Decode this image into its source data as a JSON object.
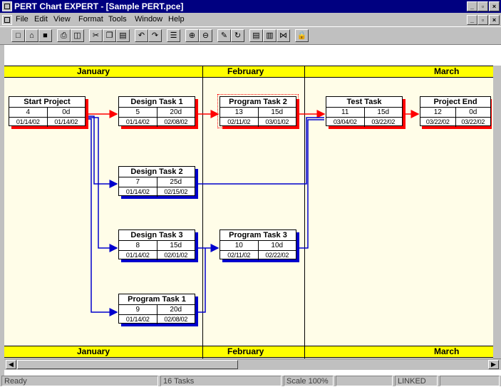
{
  "window": {
    "title": "PERT Chart EXPERT - [Sample PERT.pce]"
  },
  "menu": [
    "File",
    "Edit",
    "View",
    "Format",
    "Tools",
    "Window",
    "Help"
  ],
  "toolbar": {
    "icons": [
      "new-icon",
      "open-icon",
      "save-icon",
      "print-icon",
      "print-preview-icon",
      "cut-icon",
      "copy-icon",
      "paste-icon",
      "undo-icon",
      "redo-icon",
      "properties-icon",
      "zoom-in-icon",
      "zoom-out-icon",
      "link-icon",
      "refresh-icon",
      "view-list-icon",
      "view-columns-icon",
      "view-link-icon",
      "lock-icon"
    ]
  },
  "timescale": {
    "months": [
      "January",
      "February",
      "March"
    ]
  },
  "tasks": [
    {
      "name": "Start Project",
      "id": "4",
      "duration": "0d",
      "start": "01/14/02",
      "end": "01/14/02",
      "critical": true
    },
    {
      "name": "Design Task 1",
      "id": "5",
      "duration": "20d",
      "start": "01/14/02",
      "end": "02/08/02",
      "critical": true
    },
    {
      "name": "Program Task 2",
      "id": "13",
      "duration": "15d",
      "start": "02/11/02",
      "end": "03/01/02",
      "critical": true
    },
    {
      "name": "Test Task",
      "id": "11",
      "duration": "15d",
      "start": "03/04/02",
      "end": "03/22/02",
      "critical": true
    },
    {
      "name": "Project End",
      "id": "12",
      "duration": "0d",
      "start": "03/22/02",
      "end": "03/22/02",
      "critical": true
    },
    {
      "name": "Design Task 2",
      "id": "7",
      "duration": "25d",
      "start": "01/14/02",
      "end": "02/15/02",
      "critical": false
    },
    {
      "name": "Design Task 3",
      "id": "8",
      "duration": "15d",
      "start": "01/14/02",
      "end": "02/01/02",
      "critical": false
    },
    {
      "name": "Program Task 3",
      "id": "10",
      "duration": "10d",
      "start": "02/11/02",
      "end": "02/22/02",
      "critical": false
    },
    {
      "name": "Program Task 1",
      "id": "9",
      "duration": "20d",
      "start": "01/14/02",
      "end": "02/08/02",
      "critical": false
    }
  ],
  "status": {
    "state": "Ready",
    "count": "16 Tasks",
    "scale": "Scale 100%",
    "mode": "LINKED"
  },
  "colors": {
    "critical": "#ff0000",
    "noncritical": "#0000cc",
    "band": "#ffff00",
    "titlebar": "#000080"
  }
}
